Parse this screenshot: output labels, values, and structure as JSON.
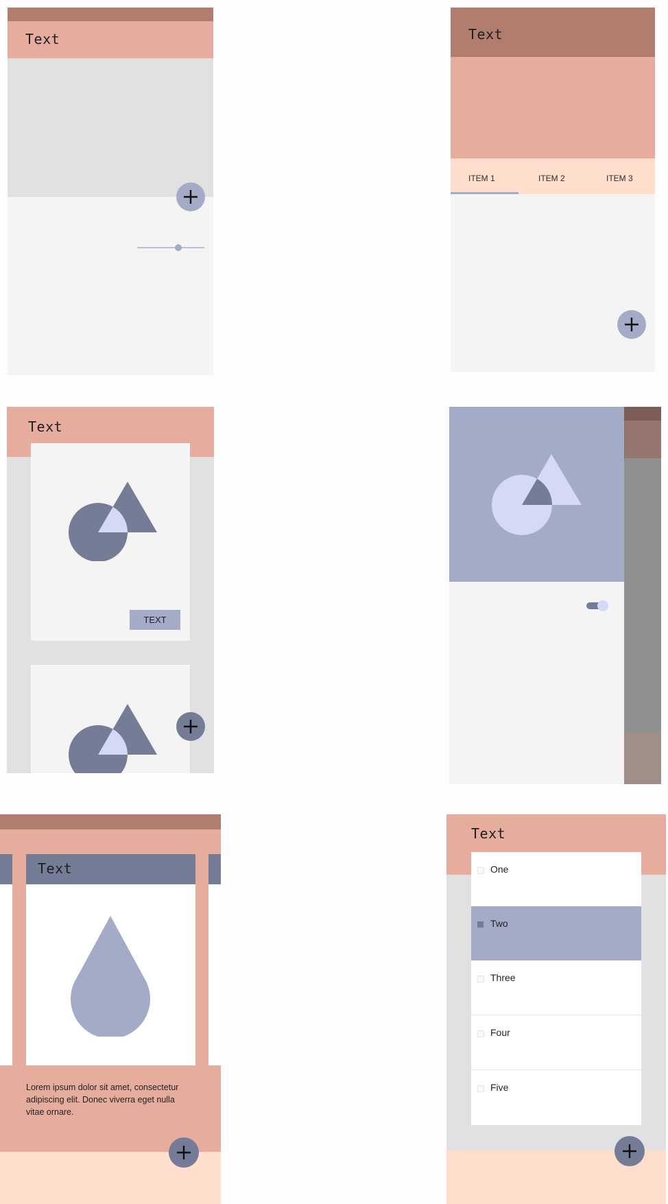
{
  "colors": {
    "status_bar": "#b07d6e",
    "app_bar": "#e6ad9e",
    "app_bar_dark": "#b07d6e",
    "surface": "#f4f4f4",
    "grey_area": "#e1e1e1",
    "accent": "#a3abc6",
    "accent_dark": "#757c96",
    "accent_light": "#d5daf4",
    "tab_bar": "#ffdecd",
    "white": "#ffffff"
  },
  "screen1": {
    "title": "Text",
    "fab_icon": "plus-icon",
    "slider": {
      "value": 0.6
    }
  },
  "screen2": {
    "title": "Text",
    "tabs": [
      {
        "label": "ITEM 1",
        "selected": true
      },
      {
        "label": "ITEM 2",
        "selected": false
      },
      {
        "label": "ITEM 3",
        "selected": false
      }
    ],
    "fab_icon": "plus-icon"
  },
  "screen3": {
    "title": "Text",
    "card_button": "TEXT",
    "fab_icon": "plus-icon"
  },
  "screen4": {
    "switch_on": true
  },
  "screen5": {
    "card_title": "Text",
    "body": "Lorem ipsum dolor sit amet, consectetur adipiscing elit. Donec viverra eget nulla vitae ornare.",
    "body_lines": [
      "Lorem ipsum dolor sit amet, consectetur",
      "adipiscing elit. Donec viverra eget nulla",
      "vitae ornare."
    ],
    "fab_icon": "plus-icon"
  },
  "screen6": {
    "title": "Text",
    "items": [
      {
        "label": "One",
        "selected": false
      },
      {
        "label": "Two",
        "selected": true
      },
      {
        "label": "Three",
        "selected": false
      },
      {
        "label": "Four",
        "selected": false
      },
      {
        "label": "Five",
        "selected": false
      }
    ],
    "fab_icon": "plus-icon"
  }
}
